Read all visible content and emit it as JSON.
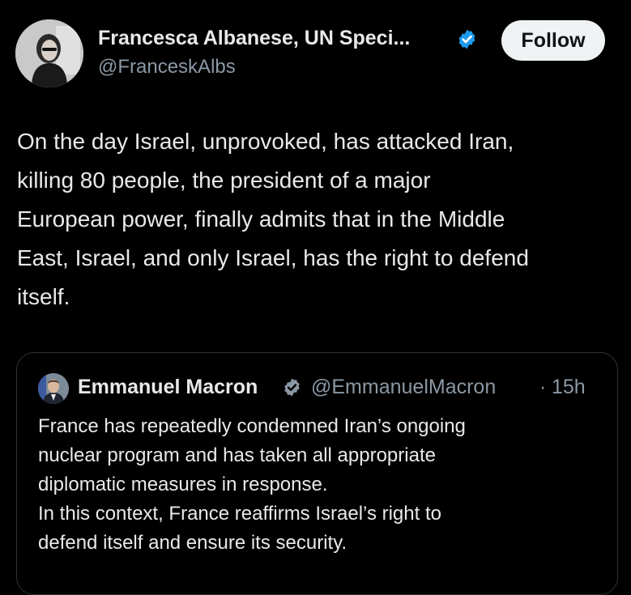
{
  "post": {
    "author_name": "Francesca Albanese, UN Speci...",
    "handle": "@FranceskAlbs",
    "verified_icon": "verified-badge-icon",
    "follow_label": "Follow",
    "text": "On the day Israel, unprovoked, has attacked Iran,\nkilling 80 people, the president of a major\nEuropean power, finally admits that in the Middle\nEast, Israel, and only Israel, has the right to defend\nitself."
  },
  "quoted": {
    "author_name": "Emmanuel Macron",
    "handle": "@EmmanuelMacron",
    "separator": "·",
    "time": "15h",
    "verified_icon": "verified-badge-icon",
    "text": "France has repeatedly condemned Iran’s ongoing\nnuclear program and has taken all appropriate\ndiplomatic measures in response.\nIn this context, France reaffirms Israel’s right to\ndefend itself and ensure its security."
  },
  "colors": {
    "background": "#000000",
    "primary_text": "#e7e9ea",
    "secondary_text": "#8b98a5",
    "verified_blue": "#1d9bf0",
    "follow_bg": "#eff3f4",
    "card_border": "#2f3336"
  }
}
